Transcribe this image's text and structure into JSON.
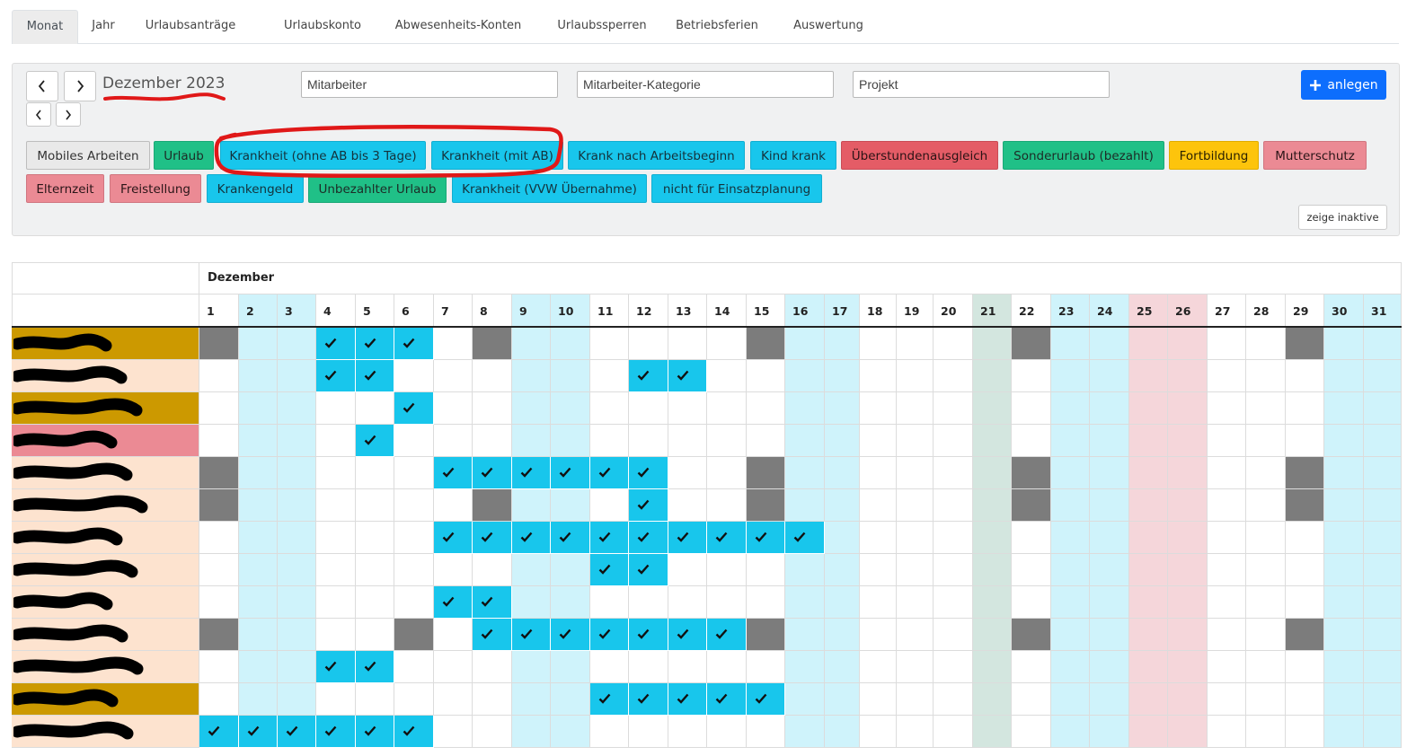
{
  "tabs": [
    {
      "label": "Monat",
      "active": true
    },
    {
      "label": "Jahr",
      "active": false
    },
    {
      "label": "Urlaubsanträge",
      "active": false
    },
    {
      "label": "Urlaubskonto",
      "active": false
    },
    {
      "label": "Abwesenheits-Konten",
      "active": false
    },
    {
      "label": "Urlaubssperren",
      "active": false
    },
    {
      "label": "Betriebsferien",
      "active": false
    },
    {
      "label": "Auswertung",
      "active": false
    }
  ],
  "toolbar": {
    "month_label": "Dezember 2023",
    "employee_placeholder": "Mitarbeiter",
    "category_placeholder": "Mitarbeiter-Kategorie",
    "project_placeholder": "Projekt",
    "add_label": "anlegen",
    "show_inactive_label": "zeige inaktive"
  },
  "absence_types": [
    {
      "label": "Mobiles Arbeiten",
      "color": "grey"
    },
    {
      "label": "Urlaub",
      "color": "green"
    },
    {
      "label": "Krankheit (ohne AB bis 3 Tage)",
      "color": "cyan"
    },
    {
      "label": "Krankheit (mit AB)",
      "color": "cyan"
    },
    {
      "label": "Krank nach Arbeitsbeginn",
      "color": "cyan"
    },
    {
      "label": "Kind krank",
      "color": "cyan"
    },
    {
      "label": "Überstundenausgleich",
      "color": "red"
    },
    {
      "label": "Sonderurlaub (bezahlt)",
      "color": "green"
    },
    {
      "label": "Fortbildung",
      "color": "yellow"
    },
    {
      "label": "Mutterschutz",
      "color": "pink"
    },
    {
      "label": "Elternzeit",
      "color": "pink"
    },
    {
      "label": "Freistellung",
      "color": "pink"
    },
    {
      "label": "Krankengeld",
      "color": "cyan"
    },
    {
      "label": "Unbezahlter Urlaub",
      "color": "green"
    },
    {
      "label": "Krankheit (VVW Übernahme)",
      "color": "cyan"
    },
    {
      "label": "nicht für Einsatzplanung",
      "color": "cyan"
    }
  ],
  "calendar": {
    "month_header": "Dezember",
    "days": [
      "1",
      "2",
      "3",
      "4",
      "5",
      "6",
      "7",
      "8",
      "9",
      "10",
      "11",
      "12",
      "13",
      "14",
      "15",
      "16",
      "17",
      "18",
      "19",
      "20",
      "21",
      "22",
      "23",
      "24",
      "25",
      "26",
      "27",
      "28",
      "29",
      "30",
      "31"
    ],
    "weekend_days": [
      2,
      3,
      9,
      10,
      16,
      17,
      23,
      24,
      30,
      31
    ],
    "holiday_days": [
      25,
      26
    ],
    "special_day": 21,
    "colors": {
      "weekend": "#cff3fb",
      "holiday": "#f5d6da",
      "special": "#d3e6df",
      "absence": "#18c6ec",
      "mobile": "#7c7c7c",
      "row_gold": "#cc9900",
      "row_peach": "#fde3cf",
      "row_pink": "#eb8a94"
    },
    "rows": [
      {
        "name_color": "gold",
        "checks": [
          4,
          5,
          6
        ],
        "mobile": [
          1,
          8,
          15,
          22,
          29
        ]
      },
      {
        "name_color": "peach",
        "checks": [
          4,
          5,
          12,
          13
        ],
        "mobile": []
      },
      {
        "name_color": "gold",
        "checks": [
          6
        ],
        "mobile": []
      },
      {
        "name_color": "pink",
        "checks": [
          5
        ],
        "mobile": []
      },
      {
        "name_color": "peach",
        "checks": [
          7,
          8,
          9,
          10,
          11,
          12
        ],
        "mobile": [
          1,
          15,
          22,
          29
        ]
      },
      {
        "name_color": "peach",
        "checks": [
          12
        ],
        "mobile": [
          1,
          8,
          15,
          22,
          29
        ]
      },
      {
        "name_color": "peach",
        "checks": [
          7,
          8,
          9,
          10,
          11,
          12,
          13,
          14,
          15,
          16
        ],
        "mobile": []
      },
      {
        "name_color": "peach",
        "checks": [
          11,
          12
        ],
        "mobile": []
      },
      {
        "name_color": "peach",
        "checks": [
          7,
          8
        ],
        "mobile": []
      },
      {
        "name_color": "peach",
        "checks": [
          8,
          9,
          10,
          11,
          12,
          13,
          14
        ],
        "mobile": [
          1,
          6,
          15,
          22,
          29
        ]
      },
      {
        "name_color": "peach",
        "checks": [
          4,
          5
        ],
        "mobile": []
      },
      {
        "name_color": "gold",
        "checks": [
          11,
          12,
          13,
          14,
          15
        ],
        "mobile": []
      },
      {
        "name_color": "peach",
        "checks": [
          1,
          2,
          3,
          4,
          5,
          6
        ],
        "mobile": []
      }
    ]
  }
}
